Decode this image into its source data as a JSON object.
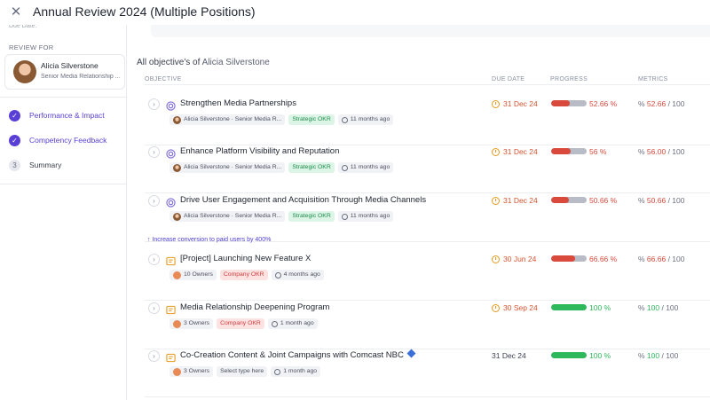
{
  "header": {
    "title": "Annual Review 2024 (Multiple Positions)",
    "close_icon": "close-icon"
  },
  "sidebar": {
    "due_fragment": "Due Date:",
    "review_for_label": "REVIEW FOR",
    "reviewee": {
      "name": "Alicia Silverstone",
      "role": "Senior Media Relationship ..."
    },
    "steps": [
      {
        "label": "Performance & Impact",
        "state": "done"
      },
      {
        "label": "Competency Feedback",
        "state": "done"
      },
      {
        "label": "Summary",
        "state": "todo",
        "number": "3"
      }
    ]
  },
  "main": {
    "section_title_prefix": "All objective's of",
    "section_title_name": "Alicia Silverstone",
    "columns": {
      "objective": "OBJECTIVE",
      "due_date": "DUE DATE",
      "progress": "PROGRESS",
      "metrics": "METRICS"
    },
    "goal_link": "Increase conversion to paid users by 400%",
    "colors": {
      "accent": "#5a3fd6",
      "red": "#d94a3d",
      "green": "#2eb85c",
      "overdue": "#d7532f"
    },
    "objectives": [
      {
        "title": "Strengthen Media Partnerships",
        "icon": "target-icon",
        "owner": "Alicia Silverstone · Senior Media R...",
        "tag": "Strategic OKR",
        "tag_type": "strategic",
        "time": "11 months ago",
        "due": "31 Dec 24",
        "overdue": true,
        "progress": 0.5266,
        "progress_text": "52.66 %",
        "metric_value": "52.66",
        "metric_total": "/ 100",
        "status": "red"
      },
      {
        "title": "Enhance Platform Visibility and Reputation",
        "icon": "target-icon",
        "owner": "Alicia Silverstone · Senior Media R...",
        "tag": "Strategic OKR",
        "tag_type": "strategic",
        "time": "11 months ago",
        "due": "31 Dec 24",
        "overdue": true,
        "progress": 0.56,
        "progress_text": "56 %",
        "metric_value": "56.00",
        "metric_total": "/ 100",
        "status": "red"
      },
      {
        "title": "Drive User Engagement and Acquisition Through Media Channels",
        "icon": "target-icon",
        "owner": "Alicia Silverstone · Senior Media R...",
        "tag": "Strategic OKR",
        "tag_type": "strategic",
        "time": "11 months ago",
        "due": "31 Dec 24",
        "overdue": true,
        "progress": 0.5066,
        "progress_text": "50.66 %",
        "metric_value": "50.66",
        "metric_total": "/ 100",
        "status": "red"
      },
      {
        "title": "[Project] Launching New Feature X",
        "icon": "project-icon",
        "owner": "10 Owners",
        "tag": "Company OKR",
        "tag_type": "company",
        "time": "4 months ago",
        "due": "30 Jun 24",
        "overdue": true,
        "progress": 0.6666,
        "progress_text": "66.66 %",
        "metric_value": "66.66",
        "metric_total": "/ 100",
        "status": "red"
      },
      {
        "title": "Media Relationship Deepening Program",
        "icon": "project-icon",
        "owner": "3 Owners",
        "tag": "Company OKR",
        "tag_type": "company",
        "time": "1 month ago",
        "due": "30 Sep 24",
        "overdue": true,
        "progress": 1.0,
        "progress_text": "100 %",
        "metric_value": "100",
        "metric_total": "/ 100",
        "status": "green"
      },
      {
        "title": "Co-Creation Content & Joint Campaigns with Comcast NBC",
        "icon": "project-icon",
        "owner": "3 Owners",
        "tag": "Select type here",
        "tag_type": "select",
        "time": "1 month ago",
        "due": "31 Dec 24",
        "overdue": false,
        "progress": 1.0,
        "progress_text": "100 %",
        "metric_value": "100",
        "metric_total": "/ 100",
        "status": "green",
        "has_badge": true
      }
    ]
  }
}
